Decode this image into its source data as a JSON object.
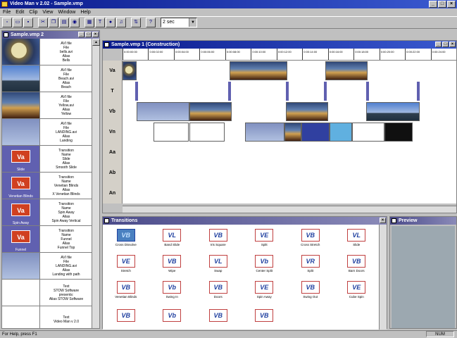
{
  "window": {
    "title": "Video Man v 2.02 - Sample.vmp"
  },
  "menu": [
    "File",
    "Edit",
    "Clip",
    "View",
    "Window",
    "Help"
  ],
  "toolbar": {
    "icons": [
      "new-icon",
      "open-icon",
      "save-icon",
      "cut-icon",
      "copy-icon",
      "paste-icon",
      "render-icon",
      "storyboard-icon",
      "text-icon",
      "record-icon",
      "volume-icon",
      "split-icon",
      "help-icon"
    ],
    "duration_combo": "2 sec"
  },
  "clips_window": {
    "title": "Sample.vmp 2",
    "items": [
      {
        "thumb": "clock",
        "lines": [
          "AVI file",
          "File",
          "bells.avi",
          "Alias",
          "Bells"
        ]
      },
      {
        "thumb": "sky",
        "lines": [
          "AVI file",
          "File",
          "Beach.avi",
          "Alias",
          "Beach"
        ]
      },
      {
        "thumb": "city",
        "lines": [
          "AVI file",
          "File",
          "Yellow.avi",
          "Alias",
          "Yellow"
        ]
      },
      {
        "thumb": "plane",
        "lines": [
          "AVI file",
          "File",
          "LANDING.avi",
          "Alias",
          "Landing"
        ]
      },
      {
        "thumb": "va",
        "caption": "Slide",
        "lines": [
          "Transition",
          "Name",
          "Slide",
          "Alias",
          "Smooth Slide"
        ]
      },
      {
        "thumb": "va",
        "caption": "Venetian Blinds",
        "lines": [
          "Transition",
          "Name",
          "Venetian Blinds",
          "Alias",
          "X Venetian Blinds"
        ]
      },
      {
        "thumb": "va",
        "caption": "Spin Away",
        "lines": [
          "Transition",
          "Name",
          "Spin Away",
          "Alias",
          "Spin Away Vertical"
        ]
      },
      {
        "thumb": "va",
        "caption": "Funnel",
        "lines": [
          "Transition",
          "Name",
          "Funnel",
          "Alias",
          "Funnel Top"
        ]
      },
      {
        "thumb": "plane",
        "lines": [
          "AVI file",
          "File",
          "LANDING.avi",
          "Alias",
          "Landing with path"
        ]
      },
      {
        "thumb": "white",
        "lines": [
          "Text",
          "STOW Software",
          "",
          "presents:",
          "Alias STOW Software"
        ]
      },
      {
        "thumb": "white",
        "lines": [
          "Text",
          "Video Man v 2.0"
        ]
      }
    ],
    "va_label": "Va"
  },
  "construction_window": {
    "title": "Sample.vmp 1 (Construction)",
    "ruler": [
      "0:00:00:00",
      "0:00:02:00",
      "0:00:04:00",
      "0:00:06:00",
      "0:00:08:00",
      "0:00:10:00",
      "0:00:12:00",
      "0:00:14:00",
      "0:00:16:00",
      "0:00:18:00",
      "0:00:20:00",
      "0:00:22:00",
      "0:00:24:00"
    ],
    "tracks": [
      "Va",
      "T",
      "Vb",
      "Vn",
      "Aa",
      "Ab",
      "An"
    ]
  },
  "transitions_window": {
    "title": "Transitions",
    "items": [
      {
        "glyph": "VB",
        "label": "Cross Dissolve"
      },
      {
        "glyph": "VL",
        "label": "Band Slide"
      },
      {
        "glyph": "VB",
        "label": "Iris Square"
      },
      {
        "glyph": "VE",
        "label": "Split"
      },
      {
        "glyph": "VB",
        "label": "Cross Stretch"
      },
      {
        "glyph": "VL",
        "label": "Slide"
      },
      {
        "glyph": "VE",
        "label": "Stretch"
      },
      {
        "glyph": "VB",
        "label": "Wipe"
      },
      {
        "glyph": "VL",
        "label": "Swap"
      },
      {
        "glyph": "Vb",
        "label": "Center Split"
      },
      {
        "glyph": "VR",
        "label": "Split"
      },
      {
        "glyph": "VB",
        "label": "Barn Doors"
      },
      {
        "glyph": "VB",
        "label": "Venetian Blinds"
      },
      {
        "glyph": "Vb",
        "label": "Swing In"
      },
      {
        "glyph": "VB",
        "label": "Doors"
      },
      {
        "glyph": "VE",
        "label": "Spin Away"
      },
      {
        "glyph": "VB",
        "label": "Swing Out"
      },
      {
        "glyph": "VE",
        "label": "Cube Spin"
      },
      {
        "glyph": "VB",
        "label": ""
      },
      {
        "glyph": "Vb",
        "label": ""
      },
      {
        "glyph": "VB",
        "label": ""
      },
      {
        "glyph": "VB",
        "label": ""
      }
    ]
  },
  "preview_window": {
    "title": "Preview"
  },
  "status": {
    "help": "For Help, press F1",
    "num": "NUM"
  },
  "colors": {
    "title_active": "#0a1a8c",
    "transition_badge": "#d04020",
    "track_marker": "#6060b0"
  }
}
